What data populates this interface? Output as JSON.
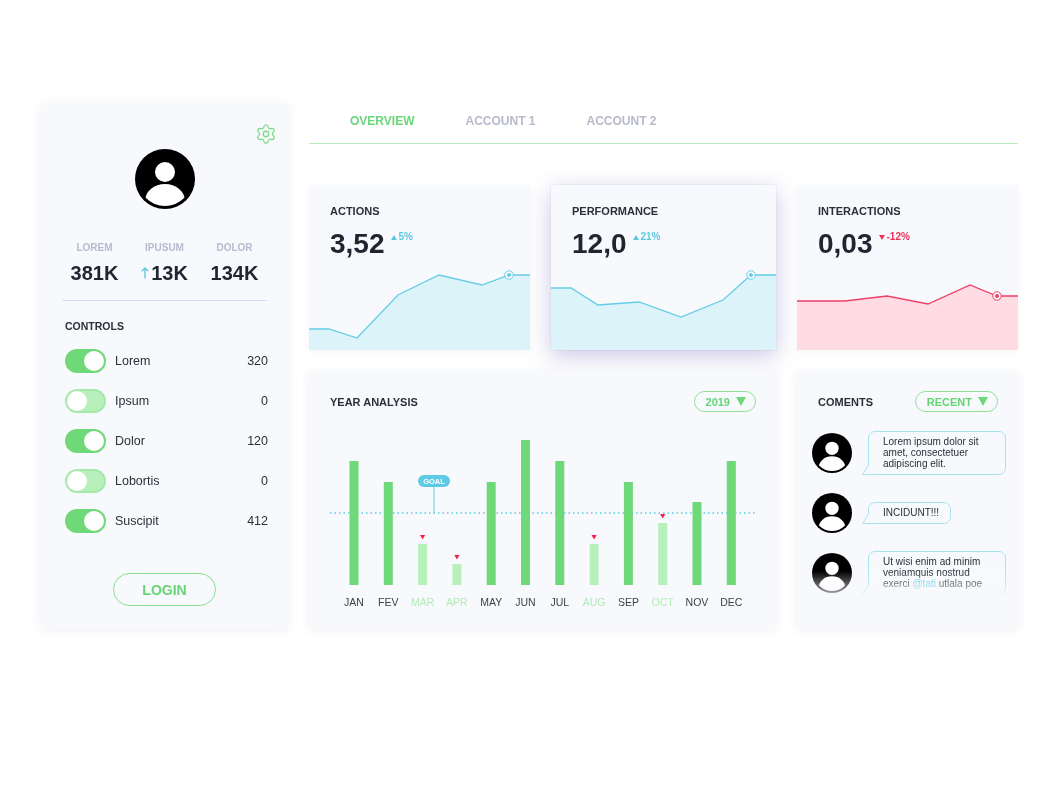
{
  "profile_stats": [
    {
      "label": "LOREM",
      "value": "381K",
      "rising": false
    },
    {
      "label": "IPUSUM",
      "value": "13K",
      "rising": true
    },
    {
      "label": "DOLOR",
      "value": "134K",
      "rising": false
    }
  ],
  "controls": {
    "title": "CONTROLS",
    "items": [
      {
        "label": "Lorem",
        "count": "320",
        "on": true
      },
      {
        "label": "Ipsum",
        "count": "0",
        "on": false
      },
      {
        "label": "Dolor",
        "count": "120",
        "on": true
      },
      {
        "label": "Lobortis",
        "count": "0",
        "on": false
      },
      {
        "label": "Suscipit",
        "count": "412",
        "on": true
      }
    ]
  },
  "login_button": "LOGIN",
  "tabs": [
    {
      "label": "OVERVIEW",
      "selected": true
    },
    {
      "label": "ACCOUNT 1",
      "selected": false
    },
    {
      "label": "ACCOUNT 2",
      "selected": false
    }
  ],
  "stat_cards": [
    {
      "title": "ACTIONS",
      "value": "3,52",
      "change": "5%",
      "rising": true,
      "highlighted": false
    },
    {
      "title": "PERFORMANCE",
      "value": "12,0",
      "change": "21%",
      "rising": true,
      "highlighted": true
    },
    {
      "title": "INTERACTIONS",
      "value": "0,03",
      "change": "-12%",
      "rising": false,
      "highlighted": false
    }
  ],
  "year_analysis": {
    "title": "YEAR ANALYSIS",
    "year_select": "2019",
    "goal_label": "GOAL",
    "months": [
      {
        "label": "JAN",
        "below_goal": false
      },
      {
        "label": "FEV",
        "below_goal": false
      },
      {
        "label": "MAR",
        "below_goal": true
      },
      {
        "label": "APR",
        "below_goal": true
      },
      {
        "label": "MAY",
        "below_goal": false
      },
      {
        "label": "JUN",
        "below_goal": false
      },
      {
        "label": "JUL",
        "below_goal": false
      },
      {
        "label": "AUG",
        "below_goal": true
      },
      {
        "label": "SEP",
        "below_goal": false
      },
      {
        "label": "OCT",
        "below_goal": true
      },
      {
        "label": "NOV",
        "below_goal": false
      },
      {
        "label": "DEC",
        "below_goal": false
      }
    ]
  },
  "comments": {
    "title": "COMENTS",
    "sort_select": "RECENT",
    "items": [
      {
        "parts": [
          {
            "kind": "text",
            "text": "Lorem ipsum dolor sit amet, consectetuer adipiscing elit."
          }
        ]
      },
      {
        "parts": [
          {
            "kind": "text",
            "text": "INCIDUNT!!!"
          }
        ]
      },
      {
        "parts": [
          {
            "kind": "text",
            "text": "Ut wisi enim ad minim veniamquis nostrud exerci "
          },
          {
            "kind": "mention",
            "text": "@tati"
          },
          {
            "kind": "text",
            "text": " utlala poe"
          }
        ]
      }
    ]
  }
}
